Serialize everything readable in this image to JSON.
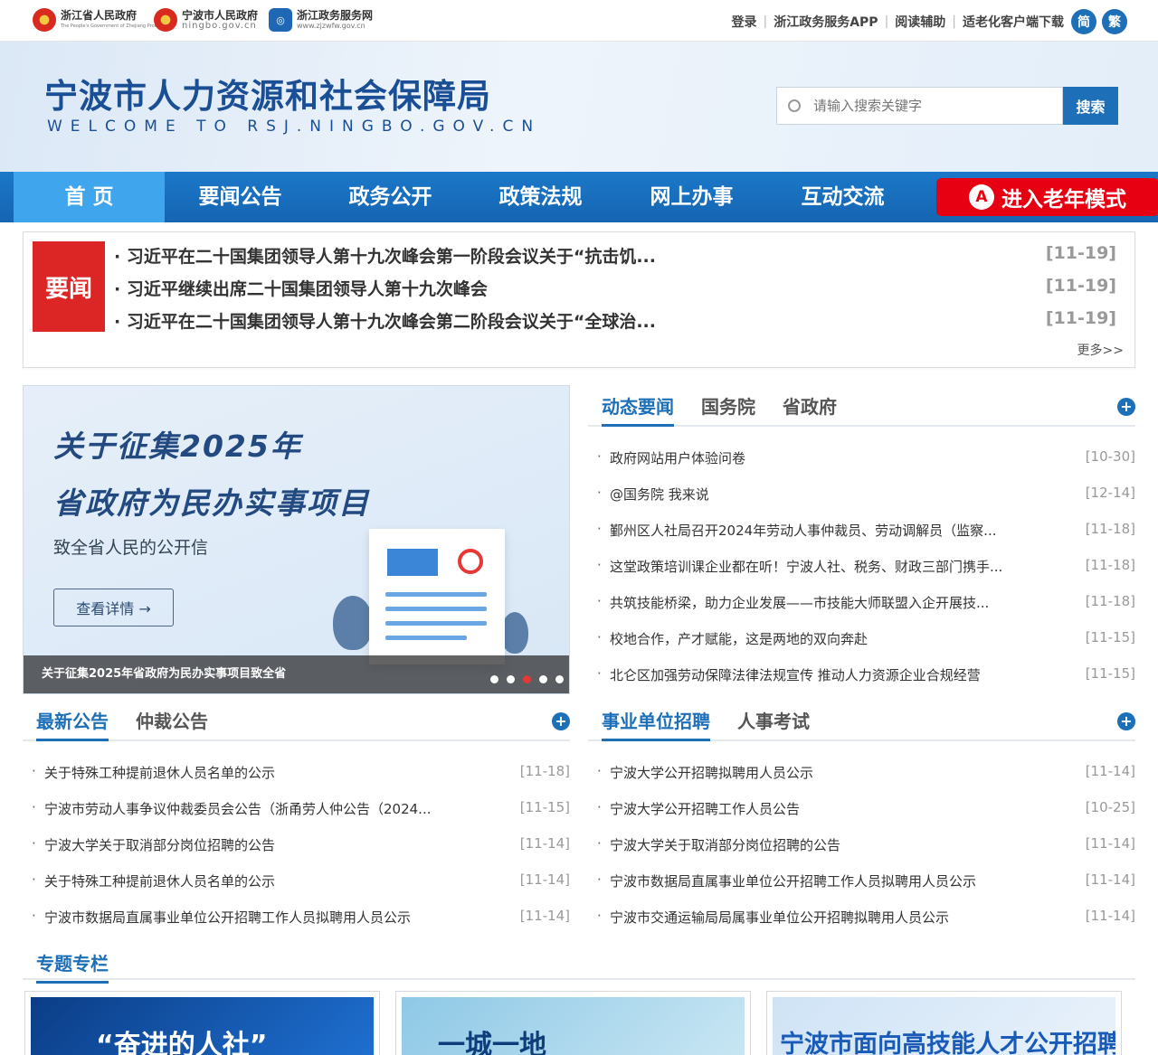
{
  "topbar": {
    "logos": [
      {
        "name": "浙江省人民政府",
        "sub": "The People's Government of Zhejiang Province"
      },
      {
        "name": "宁波市人民政府",
        "sub": "ningbo.gov.cn"
      },
      {
        "name": "浙江政务服务网",
        "sub": "www.zjzwfw.gov.cn"
      }
    ],
    "links": [
      "登录",
      "浙江政务服务APP",
      "阅读辅助",
      "适老化客户端下载"
    ],
    "simplified": "简",
    "traditional": "繁"
  },
  "header": {
    "title": "宁波市人力资源和社会保障局",
    "subtitle": "WELCOME TO RSJ.NINGBO.GOV.CN",
    "search_placeholder": "请输入搜索关键字",
    "search_button": "搜索"
  },
  "nav": {
    "items": [
      "首 页",
      "要闻公告",
      "政务公开",
      "政策法规",
      "网上办事",
      "互动交流"
    ],
    "active": 0,
    "elder_mode": "进入老年模式"
  },
  "headlines": {
    "tag": "要闻",
    "items": [
      {
        "title": "习近平在二十国集团领导人第十九次峰会第一阶段会议关于“抗击饥...",
        "date": "[11-19]"
      },
      {
        "title": "习近平继续出席二十国集团领导人第十九次峰会",
        "date": "[11-19]"
      },
      {
        "title": "习近平在二十国集团领导人第十九次峰会第二阶段会议关于“全球治...",
        "date": "[11-19]"
      }
    ],
    "more": "更多>>"
  },
  "banner": {
    "line1": "关于征集2025年",
    "line2": "省政府为民办实事项目",
    "sub": "致全省人民的公开信",
    "button": "查看详情 →",
    "caption": "关于征集2025年省政府为民办实事项目致全省",
    "slide_count": 5,
    "active_slide": 2
  },
  "news_panel": {
    "tabs": [
      "动态要闻",
      "国务院",
      "省政府"
    ],
    "active": 0,
    "items": [
      {
        "title": "政府网站用户体验问卷",
        "date": "[10-30]"
      },
      {
        "title": "@国务院 我来说",
        "date": "[12-14]"
      },
      {
        "title": "鄞州区人社局召开2024年劳动人事仲裁员、劳动调解员（监察...",
        "date": "[11-18]"
      },
      {
        "title": "这堂政策培训课企业都在听！宁波人社、税务、财政三部门携手...",
        "date": "[11-18]"
      },
      {
        "title": "共筑技能桥梁，助力企业发展——市技能大师联盟入企开展技...",
        "date": "[11-18]"
      },
      {
        "title": "校地合作，产才赋能，这是两地的双向奔赴",
        "date": "[11-15]"
      },
      {
        "title": "北仑区加强劳动保障法律法规宣传 推动人力资源企业合规经营",
        "date": "[11-15]"
      }
    ]
  },
  "notice_panel": {
    "tabs": [
      "最新公告",
      "仲裁公告"
    ],
    "active": 0,
    "items": [
      {
        "title": "关于特殊工种提前退休人员名单的公示",
        "date": "[11-18]"
      },
      {
        "title": "宁波市劳动人事争议仲裁委员会公告（浙甬劳人仲公告（2024...",
        "date": "[11-15]"
      },
      {
        "title": "宁波大学关于取消部分岗位招聘的公告",
        "date": "[11-14]"
      },
      {
        "title": "关于特殊工种提前退休人员名单的公示",
        "date": "[11-14]"
      },
      {
        "title": "宁波市数据局直属事业单位公开招聘工作人员拟聘用人员公示",
        "date": "[11-14]"
      }
    ]
  },
  "recruit_panel": {
    "tabs": [
      "事业单位招聘",
      "人事考试"
    ],
    "active": 0,
    "items": [
      {
        "title": "宁波大学公开招聘拟聘用人员公示",
        "date": "[11-14]"
      },
      {
        "title": "宁波大学公开招聘工作人员公告",
        "date": "[10-25]"
      },
      {
        "title": "宁波大学关于取消部分岗位招聘的公告",
        "date": "[11-14]"
      },
      {
        "title": "宁波市数据局直属事业单位公开招聘工作人员拟聘用人员公示",
        "date": "[11-14]"
      },
      {
        "title": "宁波市交通运输局局属事业单位公开招聘拟聘用人员公示",
        "date": "[11-14]"
      }
    ]
  },
  "special": {
    "label": "专题专栏",
    "cards": [
      "“奋进的人社”",
      "一城一地",
      "宁波市面向高技能人才公开招聘"
    ]
  },
  "colors": {
    "brand": "#1d6fb8",
    "nav": "#1b78c8",
    "alert": "#e60012"
  }
}
